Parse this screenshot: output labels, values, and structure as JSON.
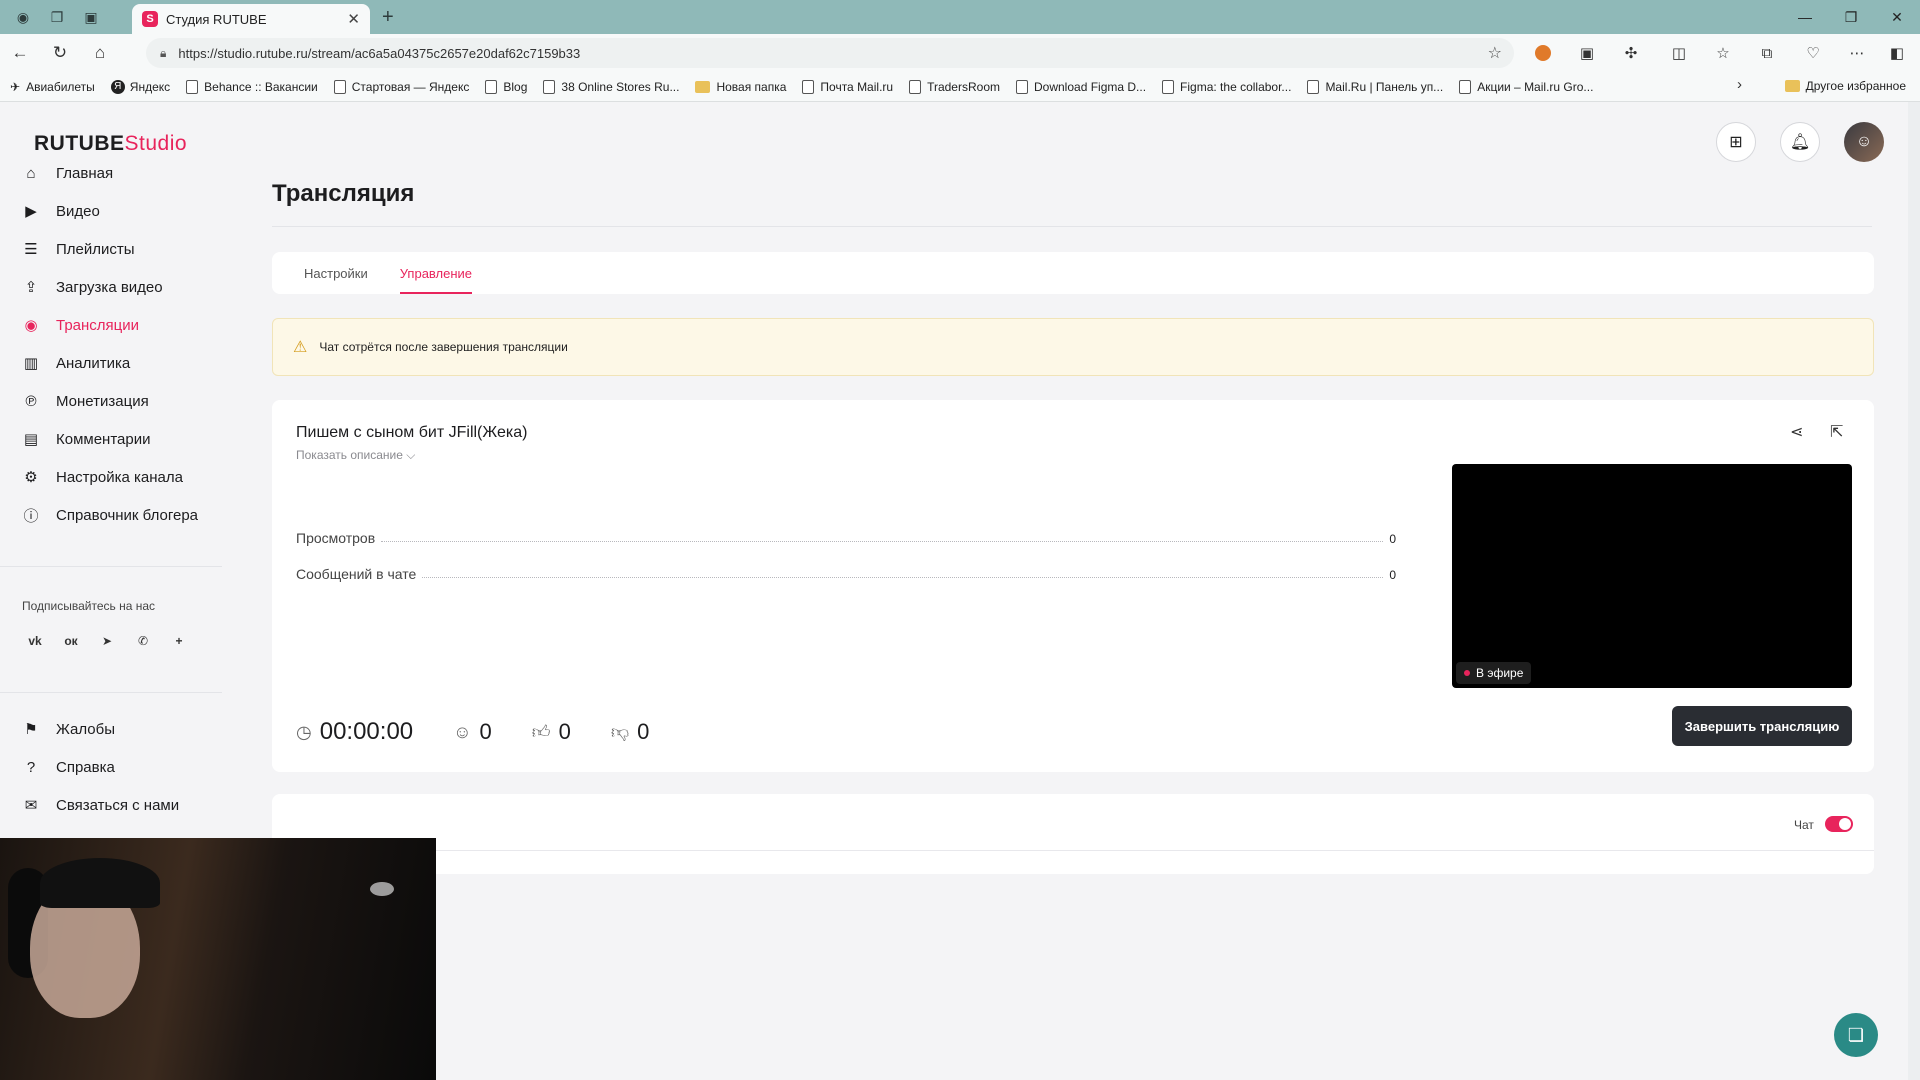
{
  "browser": {
    "tab_title": "Студия RUTUBE",
    "tab_favicon": "S",
    "url": "https://studio.rutube.ru/stream/ac6a5a04375c2657e20daf62c7159b33",
    "bookmarks": [
      {
        "label": "Авиабилеты",
        "kind": "plane"
      },
      {
        "label": "Яндекс",
        "kind": "circle"
      },
      {
        "label": "Behance :: Вакансии",
        "kind": "page"
      },
      {
        "label": "Стартовая — Яндекс",
        "kind": "page"
      },
      {
        "label": "Blog",
        "kind": "page"
      },
      {
        "label": "38 Online Stores Ru...",
        "kind": "page"
      },
      {
        "label": "Новая папка",
        "kind": "folder"
      },
      {
        "label": "Почта Mail.ru",
        "kind": "page"
      },
      {
        "label": "TradersRoom",
        "kind": "page"
      },
      {
        "label": "Download Figma D...",
        "kind": "page"
      },
      {
        "label": "Figma: the collabor...",
        "kind": "page"
      },
      {
        "label": "Mail.Ru | Панель уп...",
        "kind": "page"
      },
      {
        "label": "Акции – Mail.ru Gro...",
        "kind": "page"
      }
    ],
    "other_bookmarks": "Другое избранное"
  },
  "logo": {
    "brand": "RUTUBE",
    "suffix": "Studio"
  },
  "sidebar": {
    "items": [
      {
        "label": "Главная",
        "icon": "home-icon",
        "glyph": "⌂"
      },
      {
        "label": "Видео",
        "icon": "video-icon",
        "glyph": "▶"
      },
      {
        "label": "Плейлисты",
        "icon": "playlist-icon",
        "glyph": "☰"
      },
      {
        "label": "Загрузка видео",
        "icon": "upload-icon",
        "glyph": "⇪"
      },
      {
        "label": "Трансляции",
        "icon": "broadcast-icon",
        "glyph": "◉",
        "active": true
      },
      {
        "label": "Аналитика",
        "icon": "analytics-icon",
        "glyph": "▥"
      },
      {
        "label": "Монетизация",
        "icon": "monetization-icon",
        "glyph": "℗"
      },
      {
        "label": "Комментарии",
        "icon": "comments-icon",
        "glyph": "▤"
      },
      {
        "label": "Настройка канала",
        "icon": "settings-icon",
        "glyph": "⚙"
      },
      {
        "label": "Справочник блогера",
        "icon": "guide-icon",
        "glyph": "ⓘ"
      }
    ],
    "subscribe_label": "Подписывайтесь на нас",
    "social": [
      "vk-icon",
      "ok-icon",
      "telegram-icon",
      "viber-icon",
      "plus-icon"
    ],
    "bottom_items": [
      {
        "label": "Жалобы",
        "icon": "flag-icon",
        "glyph": "⚑"
      },
      {
        "label": "Справка",
        "icon": "help-icon",
        "glyph": "?"
      },
      {
        "label": "Связаться с нами",
        "icon": "mail-icon",
        "glyph": "✉"
      }
    ]
  },
  "page": {
    "title": "Трансляция",
    "tabs": [
      {
        "label": "Настройки",
        "active": false
      },
      {
        "label": "Управление",
        "active": true
      }
    ],
    "alert": "Чат сотрётся после завершения трансляции"
  },
  "stream": {
    "title": "Пишем с сыном бит JFill(Жека)",
    "show_description": "Показать описание ⌵",
    "stats": [
      {
        "label": "Просмотров",
        "value": "0"
      },
      {
        "label": "Сообщений в чате",
        "value": "0"
      }
    ],
    "live_badge": "В эфире",
    "end_button": "Завершить трансляцию",
    "timer": "00:00:00",
    "viewers": "0",
    "likes": "0",
    "dislikes": "0"
  },
  "chat": {
    "label": "Чат",
    "enabled": true
  },
  "colors": {
    "accent": "#e8245c",
    "dark_button": "#2a2d33",
    "alert_bg": "#fdf8e7",
    "fab": "#2a8a86"
  }
}
